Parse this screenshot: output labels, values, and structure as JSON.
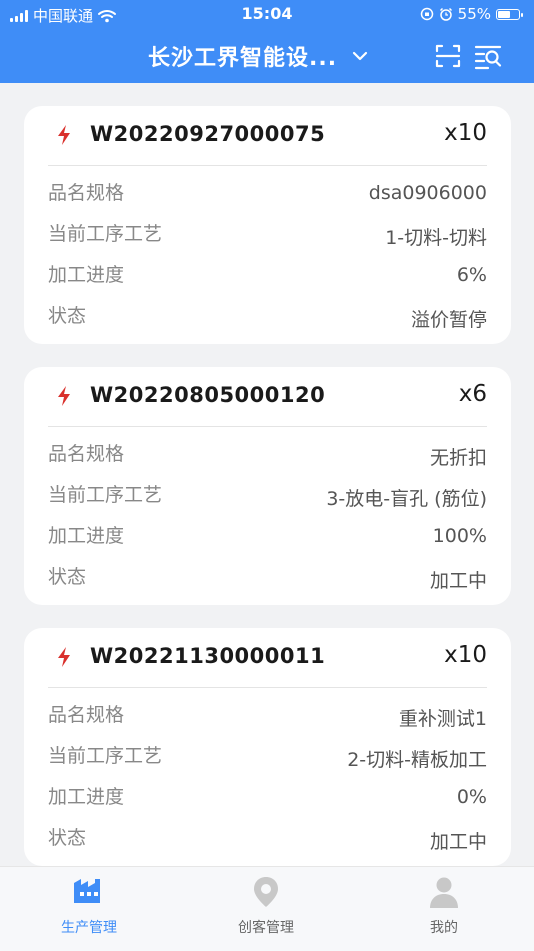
{
  "status_bar": {
    "carrier": "中国联通",
    "time": "15:04",
    "battery": "55%"
  },
  "header": {
    "title": "长沙工界智能设..."
  },
  "orders": [
    {
      "order_no": "W20220927000075",
      "qty": "x10",
      "fields": [
        {
          "label": "品名规格",
          "value": "dsa0906000"
        },
        {
          "label": "当前工序工艺",
          "value": "1-切料-切料"
        },
        {
          "label": "加工进度",
          "value": "6%"
        },
        {
          "label": "状态",
          "value": "溢价暂停"
        }
      ]
    },
    {
      "order_no": "W20220805000120",
      "qty": "x6",
      "fields": [
        {
          "label": "品名规格",
          "value": "无折扣"
        },
        {
          "label": "当前工序工艺",
          "value": "3-放电-盲孔 (筋位)"
        },
        {
          "label": "加工进度",
          "value": "100%"
        },
        {
          "label": "状态",
          "value": "加工中"
        }
      ]
    },
    {
      "order_no": "W20221130000011",
      "qty": "x10",
      "fields": [
        {
          "label": "品名规格",
          "value": "重补测试1"
        },
        {
          "label": "当前工序工艺",
          "value": "2-切料-精板加工"
        },
        {
          "label": "加工进度",
          "value": "0%"
        },
        {
          "label": "状态",
          "value": "加工中"
        }
      ]
    }
  ],
  "tabbar": {
    "tabs": [
      {
        "label": "生产管理",
        "icon": "factory-icon"
      },
      {
        "label": "创客管理",
        "icon": "location-pin-icon"
      },
      {
        "label": "我的",
        "icon": "person-icon"
      }
    ],
    "active_color": "#3f8df7",
    "inactive_color": "#c8c8c8"
  },
  "colors": {
    "header_bg": "#3f8df7",
    "bolt": "#d9302c",
    "page_bg": "#f1f2f4"
  }
}
